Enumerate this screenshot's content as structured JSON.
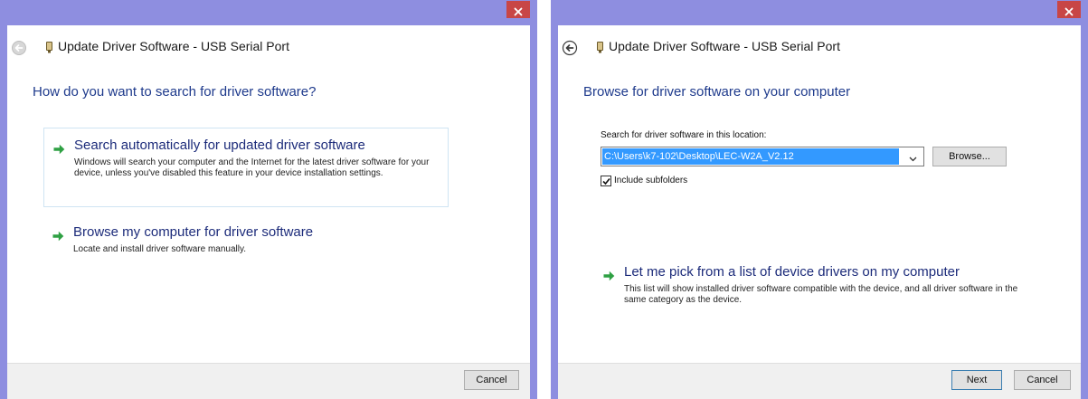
{
  "left_window": {
    "title": "Update Driver Software - USB Serial Port",
    "heading": "How do you want to search for driver software?",
    "options": [
      {
        "title": "Search automatically for updated driver software",
        "description": "Windows will search your computer and the Internet for the latest driver software for your device, unless you've disabled this feature in your device installation settings."
      },
      {
        "title": "Browse my computer for driver software",
        "description": "Locate and install driver software manually."
      }
    ],
    "cancel_label": "Cancel"
  },
  "right_window": {
    "title": "Update Driver Software - USB Serial Port",
    "heading": "Browse for driver software on your computer",
    "search_label": "Search for driver software in this location:",
    "location_value": "C:\\Users\\k7-102\\Desktop\\LEC-W2A_V2.12",
    "browse_label": "Browse...",
    "include_subfolders_label": "Include subfolders",
    "include_subfolders_checked": true,
    "pick_option": {
      "title": "Let me pick from a list of device drivers on my computer",
      "description": "This list will show installed driver software compatible with the device, and all driver software in the same category as the device."
    },
    "next_label": "Next",
    "cancel_label": "Cancel"
  },
  "icons": {
    "close": "close-icon",
    "back": "back-arrow-icon",
    "device": "usb-device-icon",
    "option_arrow": "green-arrow-icon",
    "dropdown": "chevron-down-icon",
    "check": "checkmark-icon"
  },
  "colors": {
    "window_frame": "#8e8ee0",
    "close_button": "#c84646",
    "heading_text": "#1e3a8c",
    "option_arrow": "#2ea043",
    "selection": "#3399ff"
  }
}
